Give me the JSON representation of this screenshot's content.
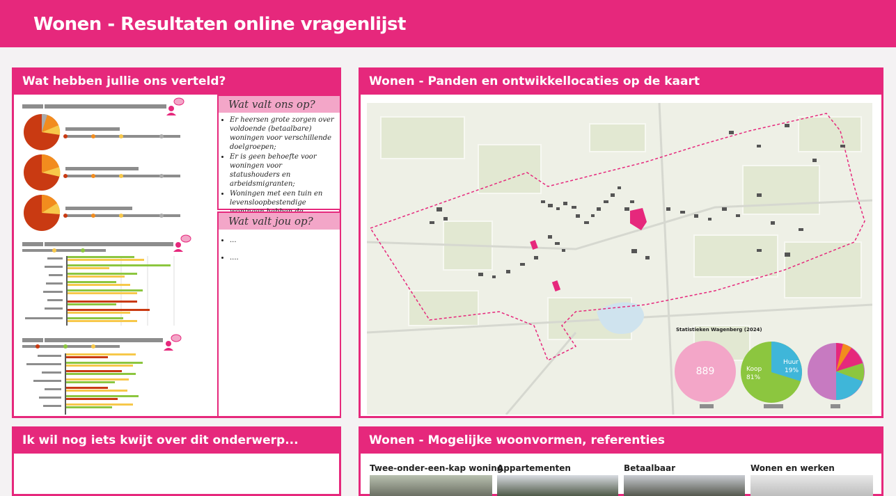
{
  "page": {
    "title": "Wonen - Resultaten online vragenlijst"
  },
  "panels": {
    "told": {
      "title": "Wat hebben jullie ons verteld?"
    },
    "map": {
      "title": "Wonen - Panden en ontwikkellocaties op de kaart"
    },
    "extra": {
      "title": "Ik wil nog iets kwijt over dit onderwerp..."
    },
    "refs": {
      "title": "Wonen - Mogelijke woonvormen, referenties"
    }
  },
  "notice_us": {
    "title": "Wat valt ons op?",
    "items": [
      "Er heersen grote zorgen over voldoende (betaalbare) woningen voor verschillende doelgroepen;",
      "Er is geen behoefte voor woningen voor statushouders en arbeidsmigranten;",
      "Woningen met een tuin en levensloopbestendige woningen hebben de voorkeur;"
    ]
  },
  "notice_you": {
    "title": "Wat valt jou op?",
    "items": [
      "...",
      "...."
    ]
  },
  "stats": {
    "title": "Statistieken Wagenberg (2024)",
    "count_value": "889",
    "koop_label": "Koop",
    "koop_pct": "81%",
    "huur_label": "Huur",
    "huur_pct": "19%"
  },
  "references": [
    {
      "label": "Twee-onder-een-kap woning"
    },
    {
      "label": "Appartementen"
    },
    {
      "label": "Betaalbaar"
    },
    {
      "label": "Wonen en werken"
    }
  ],
  "colors": {
    "brand": "#e6287c",
    "brand_light": "#f3a6c8",
    "koop": "#8cc63f",
    "huur": "#3fb6d9",
    "map_bg": "#eef0e6"
  }
}
